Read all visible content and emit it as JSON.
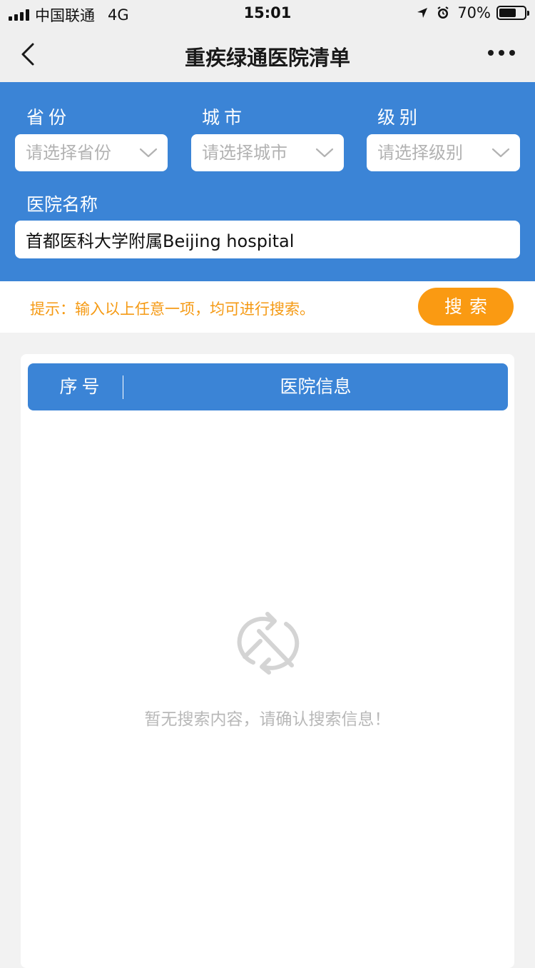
{
  "status_bar": {
    "carrier": "中国联通",
    "network": "4G",
    "time": "15:01",
    "battery": "70%",
    "battery_level": 0.7
  },
  "nav": {
    "title": "重疾绿通医院清单",
    "back_icon": "chevron-left-icon",
    "more_icon": "more-horizontal-icon"
  },
  "filters": {
    "province": {
      "label": "省份",
      "placeholder": "请选择省份"
    },
    "city": {
      "label": "城市",
      "placeholder": "请选择城市"
    },
    "level": {
      "label": "级别",
      "placeholder": "请选择级别"
    },
    "hospital_name": {
      "label": "医院名称",
      "value": "首都医科大学附属Beijing hospital"
    }
  },
  "hint": {
    "text": "提示：输入以上任意一项，均可进行搜索。",
    "search_button": "搜索"
  },
  "table": {
    "headers": [
      "序号",
      "医院信息"
    ],
    "rows": []
  },
  "empty_state": {
    "icon": "no-results-icon",
    "message": "暂无搜索内容，请确认搜索信息！"
  },
  "colors": {
    "primary_blue": "#3b84d6",
    "orange": "#fa9a12",
    "hint_orange": "#f59a14",
    "placeholder_gray": "#b2b2b2"
  }
}
